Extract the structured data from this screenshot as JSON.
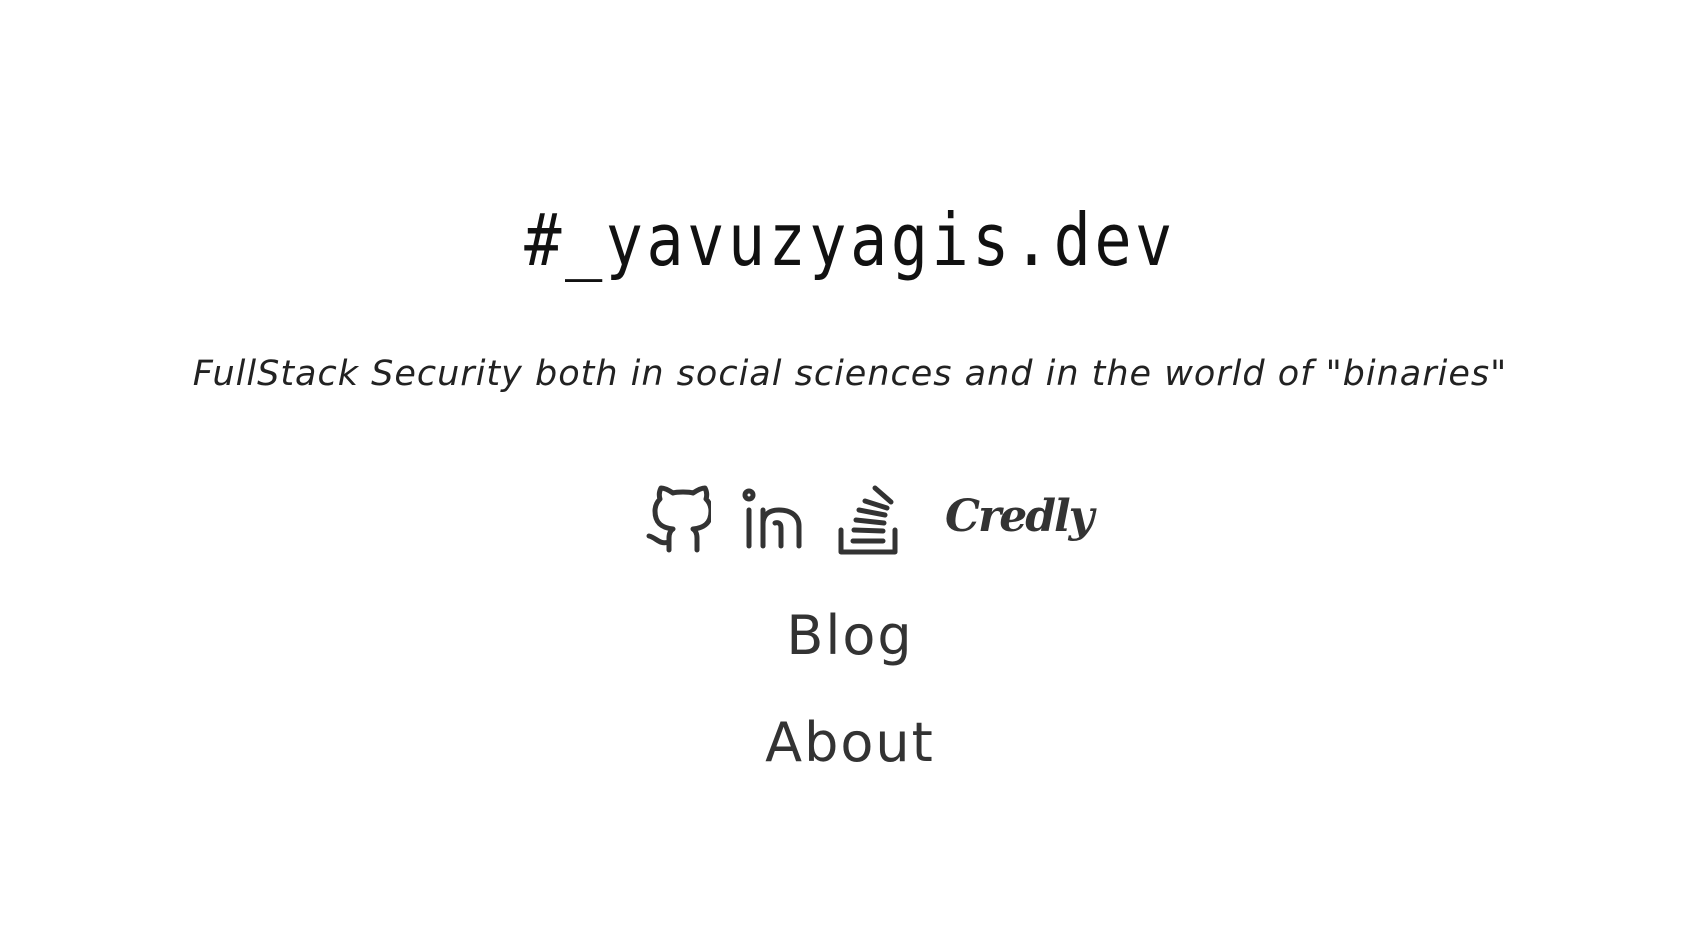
{
  "header": {
    "title": "#_yavuzyagis.dev",
    "tagline": "FullStack Security both in social sciences and in the world of \"binaries\""
  },
  "social": {
    "items": [
      {
        "name": "github",
        "icon": "github-icon"
      },
      {
        "name": "linkedin",
        "icon": "linkedin-icon"
      },
      {
        "name": "stackoverflow",
        "icon": "stackoverflow-icon"
      },
      {
        "name": "credly",
        "label": "Credly"
      }
    ]
  },
  "nav": {
    "blog_label": "Blog",
    "about_label": "About"
  },
  "colors": {
    "background": "#ffffff",
    "title": "#111111",
    "text": "#333333"
  }
}
